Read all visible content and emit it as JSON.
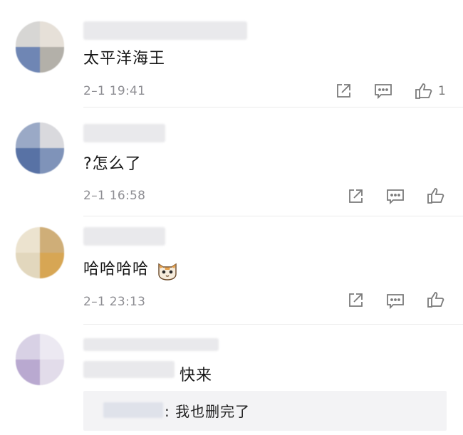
{
  "comments": [
    {
      "text": "太平洋海王",
      "time": "2–1 19:41",
      "like_count": "1",
      "avatar_colors": [
        "#d7d6d4",
        "#e6e0d8",
        "#6f86b4",
        "#b3b0a9"
      ]
    },
    {
      "text": "?怎么了",
      "time": "2–1 16:58",
      "like_count": "",
      "avatar_colors": [
        "#9aa9c6",
        "#d9d9dd",
        "#5872a5",
        "#7f93b9"
      ]
    },
    {
      "text": "哈哈哈哈",
      "time": "2–1 23:13",
      "like_count": "",
      "avatar_colors": [
        "#ece3cf",
        "#cfae78",
        "#e2d7bd",
        "#d7a654"
      ]
    },
    {
      "text": "快来",
      "avatar_colors": [
        "#d8d1e5",
        "#ece9f2",
        "#b9a9d0",
        "#e2dcea"
      ],
      "reply": {
        "text": ": 我也删完了"
      }
    }
  ],
  "icons": {
    "share": "share-icon",
    "comment": "comment-icon",
    "like": "thumbs-up-icon",
    "emoji": "cat-face-emoji"
  },
  "colors": {
    "meta": "#8e8e93",
    "text": "#161616",
    "reply_bg": "#f3f3f5"
  }
}
